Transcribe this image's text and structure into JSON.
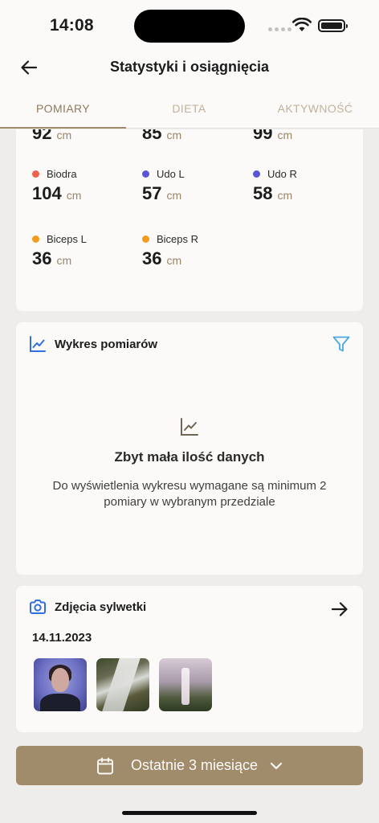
{
  "status": {
    "time": "14:08"
  },
  "header": {
    "title": "Statystyki i osiągnięcia"
  },
  "tabs": [
    {
      "label": "POMIARY",
      "active": true
    },
    {
      "label": "DIETA",
      "active": false
    },
    {
      "label": "AKTYWNOŚĆ",
      "active": false
    }
  ],
  "measurements": {
    "unit": "cm",
    "partial_top_values": [
      "92",
      "85",
      "99"
    ],
    "items": [
      {
        "label": "Biodra",
        "value": "104",
        "color": "#f0604a"
      },
      {
        "label": "Udo L",
        "value": "57",
        "color": "#5b55d6"
      },
      {
        "label": "Udo R",
        "value": "58",
        "color": "#5b55d6"
      },
      {
        "label": "Biceps L",
        "value": "36",
        "color": "#f59a1c"
      },
      {
        "label": "Biceps R",
        "value": "36",
        "color": "#f59a1c"
      }
    ]
  },
  "chart_card": {
    "title": "Wykres pomiarów",
    "empty_title": "Zbyt mała ilość danych",
    "empty_desc": "Do wyświetlenia wykresu wymagane są minimum 2 pomiary w wybranym przedziale"
  },
  "photos_card": {
    "title": "Zdjęcia sylwetki",
    "date": "14.11.2023"
  },
  "period_button": {
    "label": "Ostatnie 3 miesiące"
  },
  "colors": {
    "accent": "#a08c6a",
    "icon_blue": "#2f6fe0",
    "filter_blue": "#49a8e0"
  }
}
